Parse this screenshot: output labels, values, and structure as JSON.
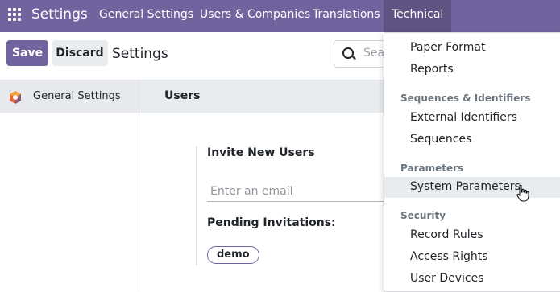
{
  "navbar": {
    "app_name": "Settings",
    "menus": [
      "General Settings",
      "Users & Companies",
      "Translations",
      "Technical"
    ],
    "active_menu": "Technical"
  },
  "control": {
    "save_label": "Save",
    "discard_label": "Discard",
    "title": "Settings",
    "search_placeholder": "Sea"
  },
  "sidebar": {
    "items": [
      {
        "label": "General Settings",
        "icon": "odoo-app-icon",
        "active": true
      }
    ]
  },
  "section": {
    "title": "Users",
    "invite_label": "Invite New Users",
    "email_placeholder": "Enter an email",
    "pending_label": "Pending Invitations:",
    "pending_badges": [
      "demo"
    ]
  },
  "dropdown": {
    "items": [
      {
        "label": "Paper Format"
      },
      {
        "label": "Reports"
      },
      {
        "header": "Sequences & Identifiers"
      },
      {
        "label": "External Identifiers"
      },
      {
        "label": "Sequences"
      },
      {
        "header": "Parameters"
      },
      {
        "label": "System Parameters",
        "hovered": true
      },
      {
        "header": "Security"
      },
      {
        "label": "Record Rules"
      },
      {
        "label": "Access Rights"
      },
      {
        "label": "User Devices"
      }
    ]
  },
  "colors": {
    "brand": "#71639e",
    "brand_dark": "#5f5383",
    "hover_bg": "#e9ecef"
  }
}
